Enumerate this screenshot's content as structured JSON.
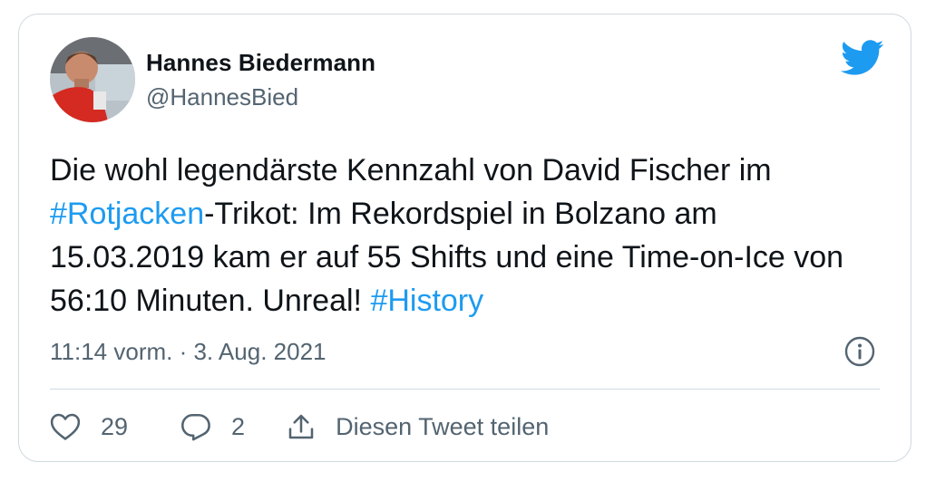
{
  "tweet": {
    "author_name": "Hannes Biedermann",
    "author_handle": "@HannesBied",
    "text_part1": "Die wohl legendärste Kennzahl von David Fischer im ",
    "hashtag1": "#Rotjacken",
    "text_part2": "-Trikot: Im Rekordspiel in Bolzano am 15.03.2019 kam er auf 55 Shifts und eine Time-on-Ice von 56:10 Minuten. Unreal! ",
    "hashtag2": "#History",
    "timestamp": "11:14 vorm. · 3. Aug. 2021",
    "like_count": "29",
    "reply_count": "2",
    "share_label": "Diesen Tweet teilen"
  },
  "icons": {
    "brand": "twitter-bird-icon",
    "info": "info-icon",
    "like": "heart-icon",
    "reply": "reply-icon",
    "share": "share-icon"
  },
  "colors": {
    "accent": "#1d9bf0",
    "text": "#0f1419",
    "muted": "#536471",
    "border": "#cfd9de"
  }
}
